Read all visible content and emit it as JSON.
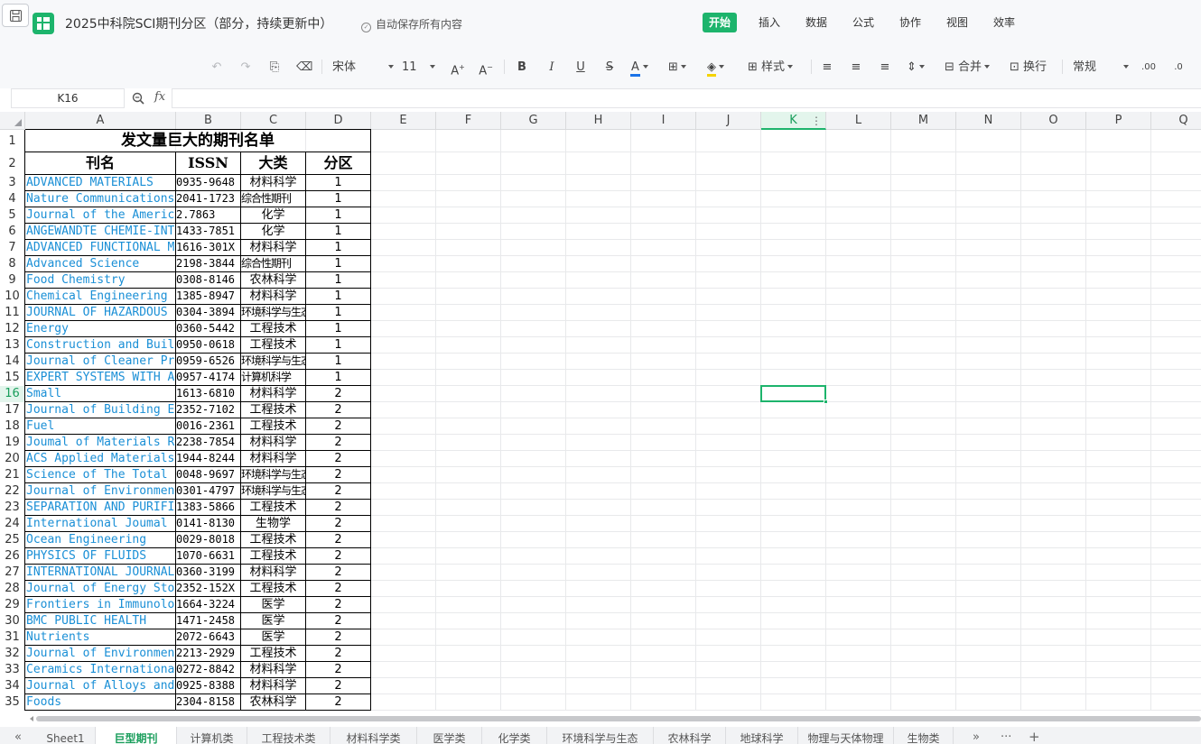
{
  "titlebar": {
    "doc_title": "2025中科院SCI期刊分区（部分，持续更新中）",
    "autosave": "自动保存所有内容",
    "menu": [
      "开始",
      "插入",
      "数据",
      "公式",
      "协作",
      "视图",
      "效率"
    ],
    "active_menu": "开始"
  },
  "toolbar": {
    "font_name": "宋体",
    "font_size": "11",
    "style_label": "样式",
    "merge_label": "合并",
    "wrap_label": "换行",
    "format_label": "常规",
    "font_color": "#1a73e8",
    "fill_color": "#f5d300"
  },
  "formula": {
    "name_box": "K16",
    "fx": "fx",
    "content": ""
  },
  "accent_color": "#1db46c",
  "columns": [
    "A",
    "B",
    "C",
    "D",
    "E",
    "F",
    "G",
    "H",
    "I",
    "J",
    "K",
    "L",
    "M",
    "N",
    "O",
    "P",
    "Q"
  ],
  "selected_column": "K",
  "selected_row": 16,
  "rows": [
    "1",
    "2",
    "3",
    "4",
    "5",
    "6",
    "7",
    "8",
    "9",
    "10",
    "11",
    "12",
    "13",
    "14",
    "15",
    "16",
    "17",
    "18",
    "19",
    "20",
    "21",
    "22",
    "23",
    "24",
    "25",
    "26",
    "27",
    "28",
    "29",
    "30",
    "31",
    "32",
    "33",
    "34",
    "35"
  ],
  "sheet": {
    "title": "发文量巨大的期刊名单",
    "headers": [
      "刊名",
      "ISSN",
      "大类",
      "分区"
    ],
    "records": [
      [
        "ADVANCED MATERIALS",
        "0935-9648",
        "材料科学",
        "1"
      ],
      [
        "Nature Communications",
        "2041-1723",
        "综合性期刊",
        "1"
      ],
      [
        "Journal of the Americ",
        "2.7863",
        "化学",
        "1"
      ],
      [
        "ANGEWANDTE CHEMIE-INT",
        "1433-7851",
        "化学",
        "1"
      ],
      [
        "ADVANCED FUNCTIONAL M",
        "1616-301X",
        "材料科学",
        "1"
      ],
      [
        "Advanced Science",
        "2198-3844",
        "综合性期刊",
        "1"
      ],
      [
        "Food Chemistry",
        "0308-8146",
        "农林科学",
        "1"
      ],
      [
        "Chemical Engineering",
        "1385-8947",
        "材料科学",
        "1"
      ],
      [
        "JOURNAL OF HAZARDOUS",
        "0304-3894",
        "环境科学与生态",
        "1"
      ],
      [
        "Energy",
        "0360-5442",
        "工程技术",
        "1"
      ],
      [
        "Construction and Buil",
        "0950-0618",
        "工程技术",
        "1"
      ],
      [
        "Journal of Cleaner Pr",
        "0959-6526",
        "环境科学与生态",
        "1"
      ],
      [
        "EXPERT SYSTEMS WITH A",
        "0957-4174",
        "计算机科学",
        "1"
      ],
      [
        "Small",
        "1613-6810",
        "材料科学",
        "2"
      ],
      [
        "Journal of Building E",
        "2352-7102",
        "工程技术",
        "2"
      ],
      [
        "Fuel",
        "0016-2361",
        "工程技术",
        "2"
      ],
      [
        "Joumal of Materials R",
        "2238-7854",
        "材料科学",
        "2"
      ],
      [
        "ACS Applied Materials",
        "1944-8244",
        "材料科学",
        "2"
      ],
      [
        "Science of The Total",
        "0048-9697",
        "环境科学与生态",
        "2"
      ],
      [
        "Journal of Environmen",
        "0301-4797",
        "环境科学与生态",
        "2"
      ],
      [
        "SEPARATION AND PURIFI",
        "1383-5866",
        "工程技术",
        "2"
      ],
      [
        "International Joumal",
        "0141-8130",
        "生物学",
        "2"
      ],
      [
        "Ocean Engineering",
        "0029-8018",
        "工程技术",
        "2"
      ],
      [
        "PHYSICS OF FLUIDS",
        "1070-6631",
        "工程技术",
        "2"
      ],
      [
        "INTERNATIONAL JOURNAL",
        "0360-3199",
        "材料科学",
        "2"
      ],
      [
        "Journal of Energy Sto",
        "2352-152X",
        "工程技术",
        "2"
      ],
      [
        "Frontiers in Immunolo",
        "1664-3224",
        "医学",
        "2"
      ],
      [
        "BMC PUBLIC HEALTH",
        "1471-2458",
        "医学",
        "2"
      ],
      [
        "Nutrients",
        "2072-6643",
        "医学",
        "2"
      ],
      [
        "Journal of Environmen",
        "2213-2929",
        "工程技术",
        "2"
      ],
      [
        "Ceramics Internationa",
        "0272-8842",
        "材料科学",
        "2"
      ],
      [
        "Journal of Alloys and",
        "0925-8388",
        "材料科学",
        "2"
      ],
      [
        "Foods",
        "2304-8158",
        "农林科学",
        "2"
      ]
    ]
  },
  "sheet_tabs": [
    "Sheet1",
    "巨型期刊",
    "计算机类",
    "工程技术类",
    "材料科学类",
    "医学类",
    "化学类",
    "环境科学与生态",
    "农林科学",
    "地球科学",
    "物理与天体物理",
    "生物类"
  ],
  "active_sheet": "巨型期刊",
  "sheetbar_buttons": {
    "prev": "«",
    "more": "»",
    "ellipsis": "···",
    "add": "+"
  }
}
